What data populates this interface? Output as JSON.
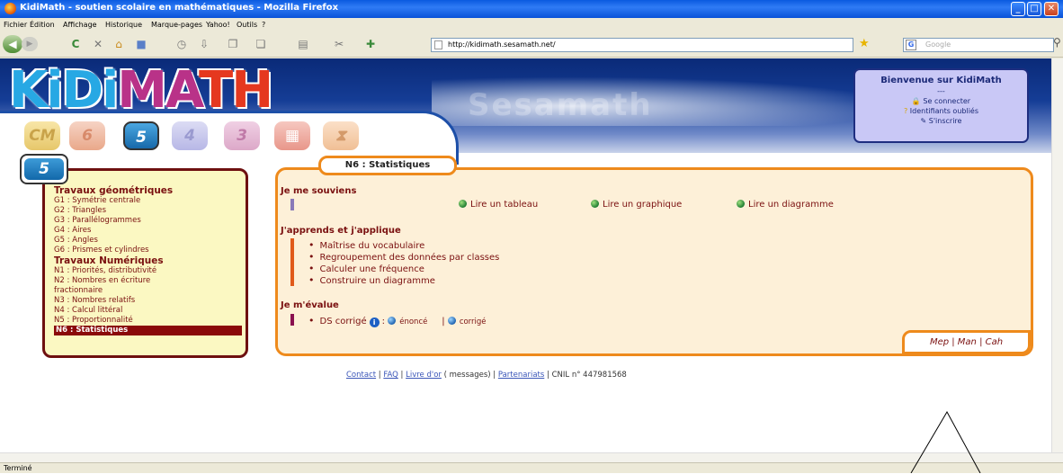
{
  "window": {
    "title": "KidiMath - soutien scolaire en mathématiques - Mozilla Firefox",
    "controls": [
      "_",
      "□",
      "✕"
    ]
  },
  "menu": [
    "Fichier",
    "Édition",
    "Affichage",
    "Historique",
    "Marque-pages",
    "Yahoo!",
    "Outils",
    "?"
  ],
  "toolbar": {
    "url": "http://kidimath.sesamath.net/",
    "search_placeholder": "Google"
  },
  "header": {
    "logo": [
      "Ki",
      "Di",
      "MA",
      "TH"
    ],
    "watermark": "Sesamath",
    "levels": [
      "CM",
      "6",
      "5",
      "4",
      "3",
      "",
      ""
    ]
  },
  "welcome": {
    "title": "Bienvenue sur KidiMath",
    "sep": "---",
    "login": "Se connecter",
    "forgot": "Identifiants oubliés",
    "register": "S'inscrire"
  },
  "level_tab": "5",
  "sidebar": {
    "sections": [
      {
        "title": "Travaux géométriques",
        "items": [
          "G1 : Symétrie centrale",
          "G2 : Triangles",
          "G3 : Parallélogrammes",
          "G4 : Aires",
          "G5 : Angles",
          "G6 : Prismes et cylindres"
        ]
      },
      {
        "title": "Travaux Numériques",
        "items": [
          "N1 : Priorités, distributivité",
          "N2 : Nombres en écriture",
          "fractionnaire",
          "N3 : Nombres relatifs",
          "N4 : Calcul littéral",
          "N5 : Proportionnalité",
          "N6 : Statistiques"
        ]
      }
    ]
  },
  "main": {
    "tab": "N6 : Statistiques",
    "souviens": {
      "title": "Je me souviens",
      "links": [
        "Lire un tableau",
        "Lire un graphique",
        "Lire un diagramme"
      ]
    },
    "apprends": {
      "title": "J'apprends et j'applique",
      "items": [
        "Maîtrise du vocabulaire",
        "Regroupement des données par classes",
        "Calculer une fréquence",
        "Construire un diagramme"
      ]
    },
    "evalue": {
      "title": "Je m'évalue",
      "ds": "DS corrigé",
      "colon": ":",
      "enonce": "énoncé",
      "sep": "|",
      "corrige": "corrigé"
    },
    "corner": "Mep | Man | Cah"
  },
  "footer": {
    "contact": "Contact",
    "faq": "FAQ",
    "livre": "Livre d'or",
    "messages": "( messages)",
    "partenariats": "Partenariats",
    "cnil": "CNIL n° 447981568",
    "sep": "|"
  },
  "status": "Terminé",
  "colors": {
    "accent_orange": "#ee8a1c",
    "menu_red": "#7a1010",
    "banner_blue": "#153d96"
  }
}
